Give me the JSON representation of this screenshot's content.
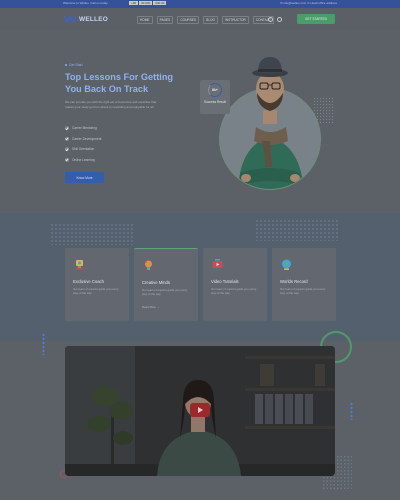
{
  "topbar": {
    "left_text": "Welcome to Welleo. Call us today",
    "phone_badges": [
      "+00",
      "00 000",
      "000 00"
    ],
    "right_text": "✉  info@welleo.com   ⊙  Head office address"
  },
  "header": {
    "logo_text": "WELLEO",
    "nav": [
      "HOME",
      "PAGES",
      "COURSES",
      "BLOG",
      "INSTRUCTOR",
      "CONTACT"
    ],
    "cta_label": "GET STARTED"
  },
  "hero": {
    "kicker": "Get Start",
    "title": "Top Lessons For Getting You Back On Track",
    "description": "We can provide you with the right set of resources and expertise that makes your study go from stress to rewarding and enjoyable for all.",
    "list": [
      "Career Mentoring",
      "Career Development",
      "Skill Orientation",
      "Online Learning"
    ],
    "button_label": "Know More",
    "badge_number": "8k+",
    "badge_label": "Success Result"
  },
  "features": [
    {
      "title": "Exclusive Coach",
      "desc": "Our team of experts guide you every step of the way.",
      "link": "",
      "icon": "trophy-icon",
      "color": "#d9b45a"
    },
    {
      "title": "Creative Minds",
      "desc": "Our team of experts guide you every step of the way.",
      "link": "Read More →",
      "icon": "bulb-icon",
      "color": "#d9924a"
    },
    {
      "title": "Video Tutorials",
      "desc": "Our team of experts guide you every step of the way.",
      "link": "",
      "icon": "video-icon",
      "color": "#c94a5a"
    },
    {
      "title": "Worlds Record",
      "desc": "Our team of experts guide you every step of the way.",
      "link": "",
      "icon": "globe-icon",
      "color": "#4ab48a"
    }
  ],
  "colors": {
    "primary": "#345dad",
    "accent_green": "#4e9b68",
    "play_red": "#9a2a2a"
  }
}
